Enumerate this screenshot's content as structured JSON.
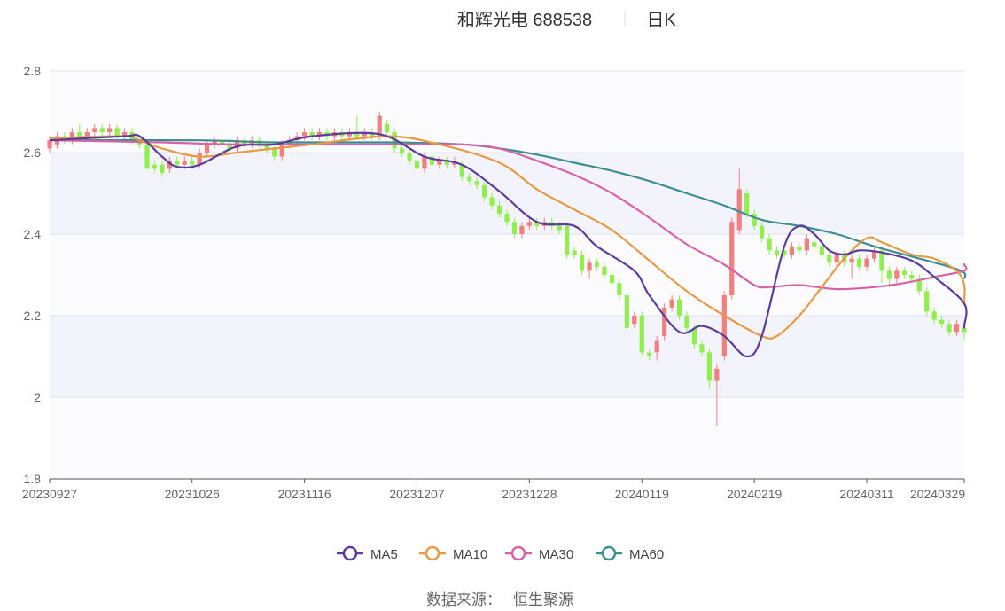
{
  "header": {
    "stock": "和辉光电 688538",
    "period": "日K"
  },
  "source": {
    "label": "数据来源：",
    "value": "恒生聚源"
  },
  "chart_data": {
    "type": "candlestick",
    "title": "和辉光电 688538",
    "subtitle": "日K",
    "ylim": [
      1.8,
      2.8
    ],
    "yticks": [
      "1.8",
      "2",
      "2.2",
      "2.4",
      "2.6",
      "2.8"
    ],
    "ytick_values": [
      1.8,
      2.0,
      2.2,
      2.4,
      2.6,
      2.8
    ],
    "xticks": [
      "20230927",
      "20231026",
      "20231116",
      "20231207",
      "20231228",
      "20240119",
      "20240219",
      "20240311",
      "20240329"
    ],
    "xtick_indices": [
      0,
      19,
      34,
      49,
      64,
      79,
      94,
      109,
      122
    ],
    "n_days": 123,
    "grid": true,
    "legend_position": "bottom",
    "up_color": "#f08080",
    "down_color": "#90ee4f",
    "series": [
      {
        "name": "MA5",
        "color": "#5b3c9c"
      },
      {
        "name": "MA10",
        "color": "#e69a45"
      },
      {
        "name": "MA30",
        "color": "#d762a8"
      },
      {
        "name": "MA60",
        "color": "#3d8e8e"
      }
    ],
    "candles": [
      [
        2.61,
        2.63,
        2.64,
        2.6
      ],
      [
        2.62,
        2.64,
        2.65,
        2.61
      ],
      [
        2.64,
        2.63,
        2.65,
        2.62
      ],
      [
        2.63,
        2.65,
        2.66,
        2.62
      ],
      [
        2.65,
        2.64,
        2.67,
        2.63
      ],
      [
        2.64,
        2.65,
        2.66,
        2.63
      ],
      [
        2.65,
        2.66,
        2.67,
        2.64
      ],
      [
        2.66,
        2.65,
        2.67,
        2.64
      ],
      [
        2.65,
        2.66,
        2.67,
        2.64
      ],
      [
        2.66,
        2.64,
        2.67,
        2.63
      ],
      [
        2.64,
        2.65,
        2.66,
        2.63
      ],
      [
        2.65,
        2.63,
        2.66,
        2.62
      ],
      [
        2.63,
        2.62,
        2.64,
        2.61
      ],
      [
        2.62,
        2.56,
        2.63,
        2.56
      ],
      [
        2.57,
        2.56,
        2.58,
        2.55
      ],
      [
        2.57,
        2.55,
        2.58,
        2.54
      ],
      [
        2.56,
        2.58,
        2.59,
        2.55
      ],
      [
        2.58,
        2.57,
        2.59,
        2.56
      ],
      [
        2.57,
        2.58,
        2.59,
        2.56
      ],
      [
        2.58,
        2.57,
        2.59,
        2.56
      ],
      [
        2.57,
        2.6,
        2.61,
        2.56
      ],
      [
        2.6,
        2.62,
        2.63,
        2.59
      ],
      [
        2.62,
        2.63,
        2.64,
        2.61
      ],
      [
        2.63,
        2.62,
        2.64,
        2.61
      ],
      [
        2.62,
        2.61,
        2.63,
        2.6
      ],
      [
        2.61,
        2.63,
        2.64,
        2.6
      ],
      [
        2.63,
        2.62,
        2.64,
        2.61
      ],
      [
        2.62,
        2.63,
        2.64,
        2.61
      ],
      [
        2.63,
        2.62,
        2.64,
        2.61
      ],
      [
        2.62,
        2.61,
        2.63,
        2.6
      ],
      [
        2.61,
        2.59,
        2.62,
        2.58
      ],
      [
        2.59,
        2.62,
        2.63,
        2.58
      ],
      [
        2.62,
        2.63,
        2.64,
        2.61
      ],
      [
        2.63,
        2.64,
        2.65,
        2.62
      ],
      [
        2.64,
        2.65,
        2.66,
        2.63
      ],
      [
        2.65,
        2.64,
        2.66,
        2.63
      ],
      [
        2.64,
        2.65,
        2.66,
        2.63
      ],
      [
        2.65,
        2.64,
        2.66,
        2.63
      ],
      [
        2.64,
        2.65,
        2.66,
        2.63
      ],
      [
        2.65,
        2.64,
        2.66,
        2.63
      ],
      [
        2.64,
        2.65,
        2.66,
        2.63
      ],
      [
        2.65,
        2.64,
        2.69,
        2.63
      ],
      [
        2.64,
        2.65,
        2.66,
        2.63
      ],
      [
        2.65,
        2.64,
        2.66,
        2.63
      ],
      [
        2.64,
        2.69,
        2.7,
        2.63
      ],
      [
        2.67,
        2.65,
        2.68,
        2.64
      ],
      [
        2.65,
        2.61,
        2.66,
        2.6
      ],
      [
        2.61,
        2.6,
        2.62,
        2.59
      ],
      [
        2.6,
        2.58,
        2.61,
        2.57
      ],
      [
        2.58,
        2.56,
        2.59,
        2.55
      ],
      [
        2.56,
        2.59,
        2.6,
        2.55
      ],
      [
        2.59,
        2.57,
        2.6,
        2.56
      ],
      [
        2.57,
        2.58,
        2.59,
        2.56
      ],
      [
        2.58,
        2.57,
        2.59,
        2.56
      ],
      [
        2.57,
        2.58,
        2.59,
        2.56
      ],
      [
        2.57,
        2.54,
        2.58,
        2.53
      ],
      [
        2.54,
        2.53,
        2.55,
        2.52
      ],
      [
        2.53,
        2.52,
        2.54,
        2.51
      ],
      [
        2.52,
        2.49,
        2.53,
        2.48
      ],
      [
        2.49,
        2.47,
        2.5,
        2.46
      ],
      [
        2.47,
        2.45,
        2.48,
        2.44
      ],
      [
        2.45,
        2.43,
        2.46,
        2.42
      ],
      [
        2.43,
        2.4,
        2.44,
        2.39
      ],
      [
        2.4,
        2.42,
        2.43,
        2.39
      ],
      [
        2.42,
        2.43,
        2.44,
        2.41
      ],
      [
        2.43,
        2.42,
        2.44,
        2.41
      ],
      [
        2.42,
        2.43,
        2.44,
        2.41
      ],
      [
        2.43,
        2.42,
        2.44,
        2.41
      ],
      [
        2.42,
        2.41,
        2.43,
        2.4
      ],
      [
        2.42,
        2.35,
        2.43,
        2.34
      ],
      [
        2.36,
        2.35,
        2.37,
        2.34
      ],
      [
        2.35,
        2.31,
        2.36,
        2.3
      ],
      [
        2.31,
        2.33,
        2.34,
        2.29
      ],
      [
        2.33,
        2.32,
        2.34,
        2.31
      ],
      [
        2.32,
        2.3,
        2.33,
        2.29
      ],
      [
        2.3,
        2.28,
        2.31,
        2.27
      ],
      [
        2.28,
        2.25,
        2.29,
        2.24
      ],
      [
        2.25,
        2.17,
        2.26,
        2.16
      ],
      [
        2.18,
        2.2,
        2.21,
        2.17
      ],
      [
        2.2,
        2.11,
        2.21,
        2.1
      ],
      [
        2.11,
        2.1,
        2.12,
        2.09
      ],
      [
        2.11,
        2.14,
        2.15,
        2.09
      ],
      [
        2.15,
        2.22,
        2.23,
        2.14
      ],
      [
        2.22,
        2.24,
        2.25,
        2.21
      ],
      [
        2.24,
        2.2,
        2.25,
        2.19
      ],
      [
        2.2,
        2.17,
        2.21,
        2.16
      ],
      [
        2.17,
        2.13,
        2.18,
        2.12
      ],
      [
        2.13,
        2.11,
        2.14,
        2.1
      ],
      [
        2.11,
        2.04,
        2.12,
        2.02
      ],
      [
        2.04,
        2.07,
        2.08,
        1.93
      ],
      [
        2.1,
        2.25,
        2.26,
        2.09
      ],
      [
        2.25,
        2.43,
        2.44,
        2.24
      ],
      [
        2.41,
        2.51,
        2.56,
        2.4
      ],
      [
        2.5,
        2.45,
        2.51,
        2.44
      ],
      [
        2.45,
        2.42,
        2.46,
        2.41
      ],
      [
        2.42,
        2.39,
        2.43,
        2.38
      ],
      [
        2.39,
        2.36,
        2.4,
        2.35
      ],
      [
        2.36,
        2.35,
        2.37,
        2.34
      ],
      [
        2.36,
        2.35,
        2.37,
        2.34
      ],
      [
        2.35,
        2.37,
        2.38,
        2.34
      ],
      [
        2.37,
        2.36,
        2.38,
        2.35
      ],
      [
        2.36,
        2.39,
        2.4,
        2.35
      ],
      [
        2.38,
        2.37,
        2.39,
        2.36
      ],
      [
        2.37,
        2.35,
        2.38,
        2.34
      ],
      [
        2.35,
        2.33,
        2.36,
        2.32
      ],
      [
        2.33,
        2.35,
        2.36,
        2.32
      ],
      [
        2.35,
        2.33,
        2.36,
        2.32
      ],
      [
        2.33,
        2.34,
        2.35,
        2.29
      ],
      [
        2.34,
        2.32,
        2.35,
        2.31
      ],
      [
        2.32,
        2.34,
        2.35,
        2.31
      ],
      [
        2.34,
        2.36,
        2.37,
        2.33
      ],
      [
        2.36,
        2.31,
        2.37,
        2.28
      ],
      [
        2.31,
        2.29,
        2.32,
        2.27
      ],
      [
        2.29,
        2.31,
        2.32,
        2.28
      ],
      [
        2.31,
        2.3,
        2.32,
        2.29
      ],
      [
        2.3,
        2.29,
        2.31,
        2.28
      ],
      [
        2.29,
        2.26,
        2.3,
        2.25
      ],
      [
        2.26,
        2.21,
        2.27,
        2.2
      ],
      [
        2.21,
        2.19,
        2.22,
        2.18
      ],
      [
        2.19,
        2.18,
        2.2,
        2.17
      ],
      [
        2.18,
        2.16,
        2.19,
        2.15
      ],
      [
        2.16,
        2.18,
        2.19,
        2.15
      ],
      [
        2.17,
        2.16,
        2.18,
        2.14
      ]
    ],
    "ma5_points": [
      [
        0,
        2.63
      ],
      [
        10,
        2.64
      ],
      [
        12,
        2.64
      ],
      [
        15,
        2.59
      ],
      [
        17,
        2.565
      ],
      [
        20,
        2.57
      ],
      [
        25,
        2.615
      ],
      [
        30,
        2.62
      ],
      [
        35,
        2.64
      ],
      [
        44,
        2.645
      ],
      [
        50,
        2.59
      ],
      [
        55,
        2.57
      ],
      [
        60,
        2.505
      ],
      [
        65,
        2.43
      ],
      [
        70,
        2.42
      ],
      [
        73,
        2.37
      ],
      [
        78,
        2.31
      ],
      [
        80,
        2.25
      ],
      [
        84,
        2.16
      ],
      [
        87,
        2.175
      ],
      [
        90,
        2.15
      ],
      [
        93,
        2.1
      ],
      [
        95,
        2.15
      ],
      [
        98,
        2.37
      ],
      [
        100,
        2.42
      ],
      [
        102,
        2.4
      ],
      [
        104,
        2.36
      ],
      [
        106,
        2.35
      ],
      [
        108,
        2.36
      ],
      [
        111,
        2.355
      ],
      [
        115,
        2.335
      ],
      [
        118,
        2.295
      ],
      [
        122,
        2.23
      ],
      [
        125,
        2.175
      ],
      [
        127,
        2.175
      ]
    ],
    "ma10_points": [
      [
        0,
        2.635
      ],
      [
        10,
        2.64
      ],
      [
        12,
        2.63
      ],
      [
        15,
        2.61
      ],
      [
        20,
        2.59
      ],
      [
        25,
        2.6
      ],
      [
        30,
        2.61
      ],
      [
        35,
        2.62
      ],
      [
        45,
        2.64
      ],
      [
        52,
        2.62
      ],
      [
        60,
        2.575
      ],
      [
        65,
        2.51
      ],
      [
        70,
        2.46
      ],
      [
        75,
        2.41
      ],
      [
        80,
        2.335
      ],
      [
        85,
        2.26
      ],
      [
        90,
        2.2
      ],
      [
        95,
        2.15
      ],
      [
        97,
        2.15
      ],
      [
        100,
        2.2
      ],
      [
        103,
        2.27
      ],
      [
        106,
        2.34
      ],
      [
        109,
        2.39
      ],
      [
        111,
        2.38
      ],
      [
        115,
        2.35
      ],
      [
        118,
        2.34
      ],
      [
        121,
        2.31
      ],
      [
        124,
        2.275
      ],
      [
        127,
        2.24
      ],
      [
        130,
        2.225
      ]
    ],
    "ma30_points": [
      [
        0,
        2.63
      ],
      [
        15,
        2.625
      ],
      [
        25,
        2.62
      ],
      [
        40,
        2.62
      ],
      [
        48,
        2.62
      ],
      [
        55,
        2.62
      ],
      [
        60,
        2.61
      ],
      [
        65,
        2.58
      ],
      [
        70,
        2.545
      ],
      [
        75,
        2.5
      ],
      [
        80,
        2.44
      ],
      [
        85,
        2.375
      ],
      [
        90,
        2.325
      ],
      [
        94,
        2.275
      ],
      [
        96,
        2.27
      ],
      [
        100,
        2.275
      ],
      [
        105,
        2.265
      ],
      [
        110,
        2.27
      ],
      [
        114,
        2.28
      ],
      [
        118,
        2.295
      ],
      [
        122,
        2.31
      ],
      [
        126,
        2.325
      ],
      [
        129,
        2.325
      ],
      [
        131,
        2.31
      ]
    ],
    "ma60_points": [
      [
        0,
        2.63
      ],
      [
        20,
        2.63
      ],
      [
        30,
        2.625
      ],
      [
        45,
        2.625
      ],
      [
        55,
        2.62
      ],
      [
        60,
        2.61
      ],
      [
        65,
        2.595
      ],
      [
        70,
        2.575
      ],
      [
        75,
        2.555
      ],
      [
        80,
        2.53
      ],
      [
        85,
        2.5
      ],
      [
        90,
        2.47
      ],
      [
        95,
        2.435
      ],
      [
        100,
        2.42
      ],
      [
        105,
        2.4
      ],
      [
        110,
        2.37
      ],
      [
        115,
        2.345
      ],
      [
        120,
        2.32
      ],
      [
        125,
        2.305
      ],
      [
        129,
        2.29
      ]
    ]
  }
}
